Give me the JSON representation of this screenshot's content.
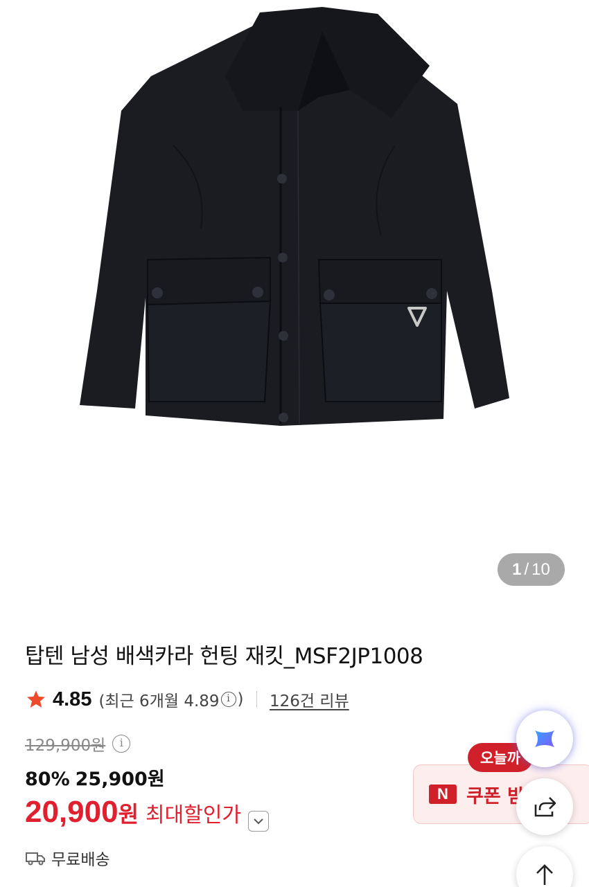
{
  "gallery": {
    "current_page": "1",
    "total_pages": "10",
    "image_icon": "jacket-product-photo"
  },
  "product": {
    "title": "탑텐 남성 배색카라 헌팅 재킷_MSF2JP1008",
    "rating": "4.85",
    "recent_prefix": "(최근 6개월 4.89",
    "recent_suffix": ")",
    "review_link": "126건 리뷰",
    "original_price": "129,900원",
    "discount_percent": "80%",
    "sale_price": "25,900원",
    "final_price": "20,900",
    "final_won": "원",
    "final_label": "최대할인가",
    "shipping": "무료배송"
  },
  "coupon": {
    "badge": "오늘까",
    "logo": "N",
    "label": "쿠폰 받"
  },
  "fabs": {
    "ai_icon": "ai-sparkle-icon",
    "share_icon": "share-icon",
    "top_icon": "arrow-up-icon"
  },
  "colors": {
    "accent_red": "#e0202e",
    "star": "#ee4b2b"
  }
}
